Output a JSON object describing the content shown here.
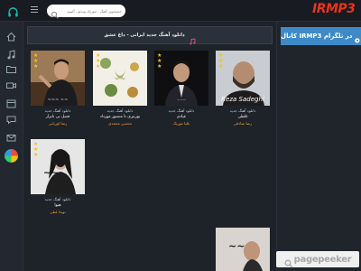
{
  "header": {
    "search_placeholder": "جستجوی آهنگ ، موزیک ویدئو ، آلبوم",
    "logo": "IRMP3"
  },
  "banner": {
    "title": "دانلود آهنگ جدید ایرانی - داغ عشق"
  },
  "cards": [
    {
      "line1": "دانلود آهنگ جدید",
      "line2": "غلطی",
      "line3": "رضا صادقی",
      "icon": "album-cover-singer-beard"
    },
    {
      "line1": "دانلود آهنگ جدید",
      "line2": "عیادی",
      "line3": "علیا موزیک",
      "icon": "album-cover-singer-suit"
    },
    {
      "line1": "دانلود آهنگ جدید",
      "line2": "بورنبری تا منصور مهرداد",
      "line3": "محسن محمدی",
      "icon": "album-cover-floral"
    },
    {
      "line1": "دانلود آهنگ جدید",
      "line2": "فصل بی ناترار",
      "line3": "رضا اوریانی",
      "icon": "album-cover-singer-arm"
    },
    {
      "line1": "دانلود آهنگ جدید",
      "line2": "هیوا",
      "line3": "نویدا غیلی",
      "icon": "album-cover-woman"
    }
  ],
  "telegram": {
    "text": "کانال IRMP3 در تلگرام"
  },
  "watermark": {
    "text": "pagepeeker"
  },
  "colors": {
    "accent": "#f0a836",
    "logo": "#e8341c",
    "telegram": "#3e8ac9",
    "background": "#1e2229"
  }
}
